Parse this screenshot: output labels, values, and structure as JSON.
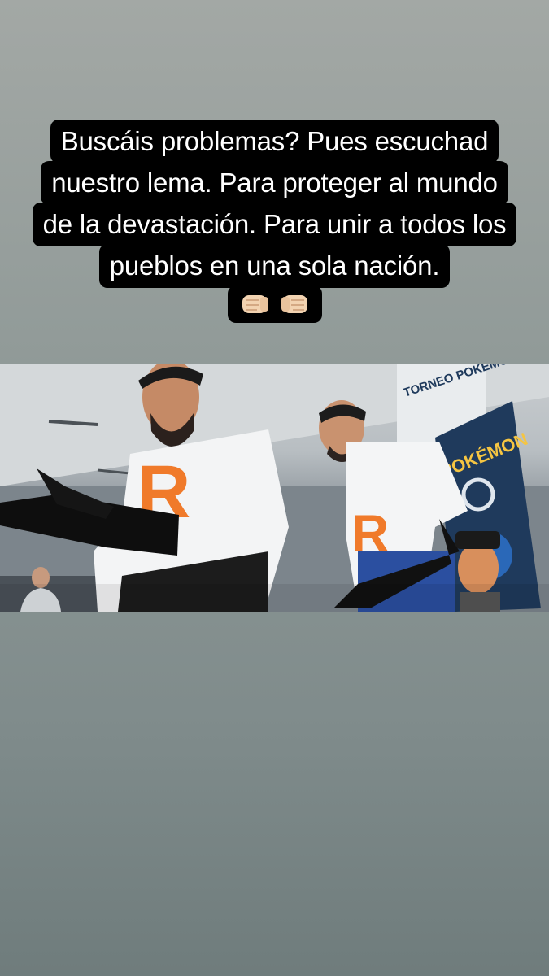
{
  "story": {
    "caption_lines": [
      "Buscáis problemas?  Pues escuchad",
      "nuestro lema.  Para proteger al mundo",
      "de la devastación. Para unir a todos los",
      "pueblos en una sola nación."
    ],
    "emoji": [
      "fist-left-icon",
      "fist-right-icon"
    ]
  },
  "photo": {
    "description": "video-still",
    "shirt_letter": "R",
    "sign_text": "TORNEO POKÉMON",
    "banner_text": "POKÉMON",
    "colors": {
      "accent_orange": "#f07a2a",
      "banner_navy": "#1f3a5c"
    }
  }
}
